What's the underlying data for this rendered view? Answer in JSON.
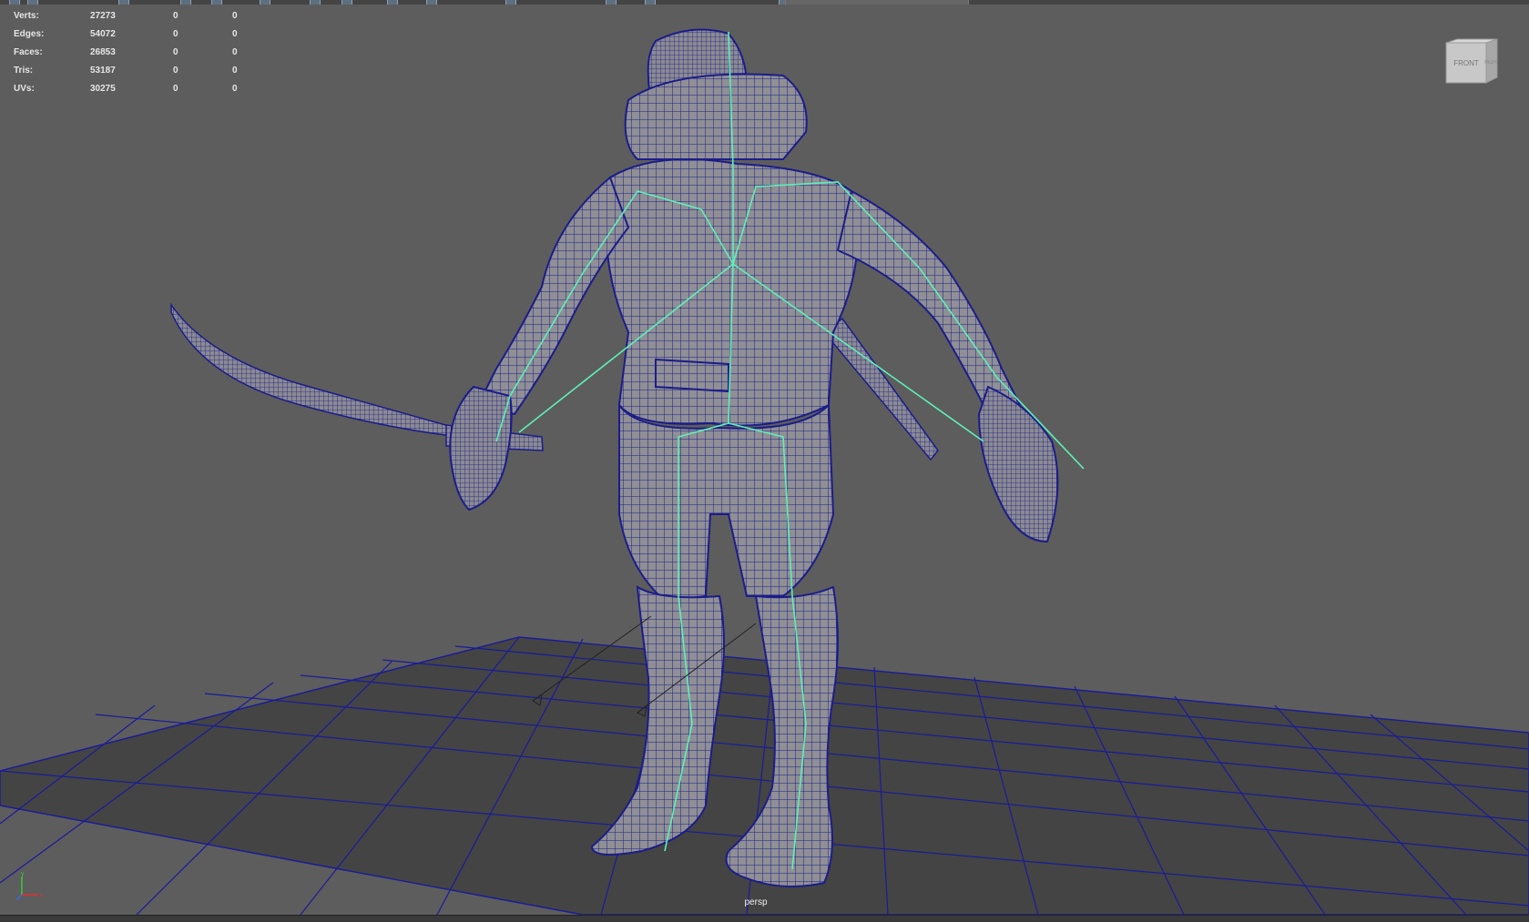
{
  "toolbar": {
    "icons": [
      "select-icon",
      "lasso-icon",
      "paint-icon",
      "move-icon",
      "rotate-icon",
      "scale-icon",
      "snap-grid-icon",
      "snap-curve-icon",
      "snap-point-icon",
      "render-icon",
      "camera-icon",
      "wireframe-icon",
      "shaded-icon",
      "texture-icon",
      "light-icon"
    ]
  },
  "hud": {
    "rows": [
      {
        "label": "Verts:",
        "v1": "27273",
        "v2": "0",
        "v3": "0"
      },
      {
        "label": "Edges:",
        "v1": "54072",
        "v2": "0",
        "v3": "0"
      },
      {
        "label": "Faces:",
        "v1": "26853",
        "v2": "0",
        "v3": "0"
      },
      {
        "label": "Tris:",
        "v1": "53187",
        "v2": "0",
        "v3": "0"
      },
      {
        "label": "UVs:",
        "v1": "30275",
        "v2": "0",
        "v3": "0"
      }
    ]
  },
  "viewcube": {
    "front_label": "FRONT",
    "right_label": "RIGHT"
  },
  "camera": {
    "name": "persp"
  },
  "axis": {
    "y": "y",
    "x": "x"
  },
  "colors": {
    "viewport_bg": "#5d5d5d",
    "grid_floor": "#444444",
    "grid_line": "#1a1a9a",
    "wireframe": "#1c1c8a",
    "mesh_fill": "#8f8f95",
    "skeleton": "#5ef0b8"
  }
}
